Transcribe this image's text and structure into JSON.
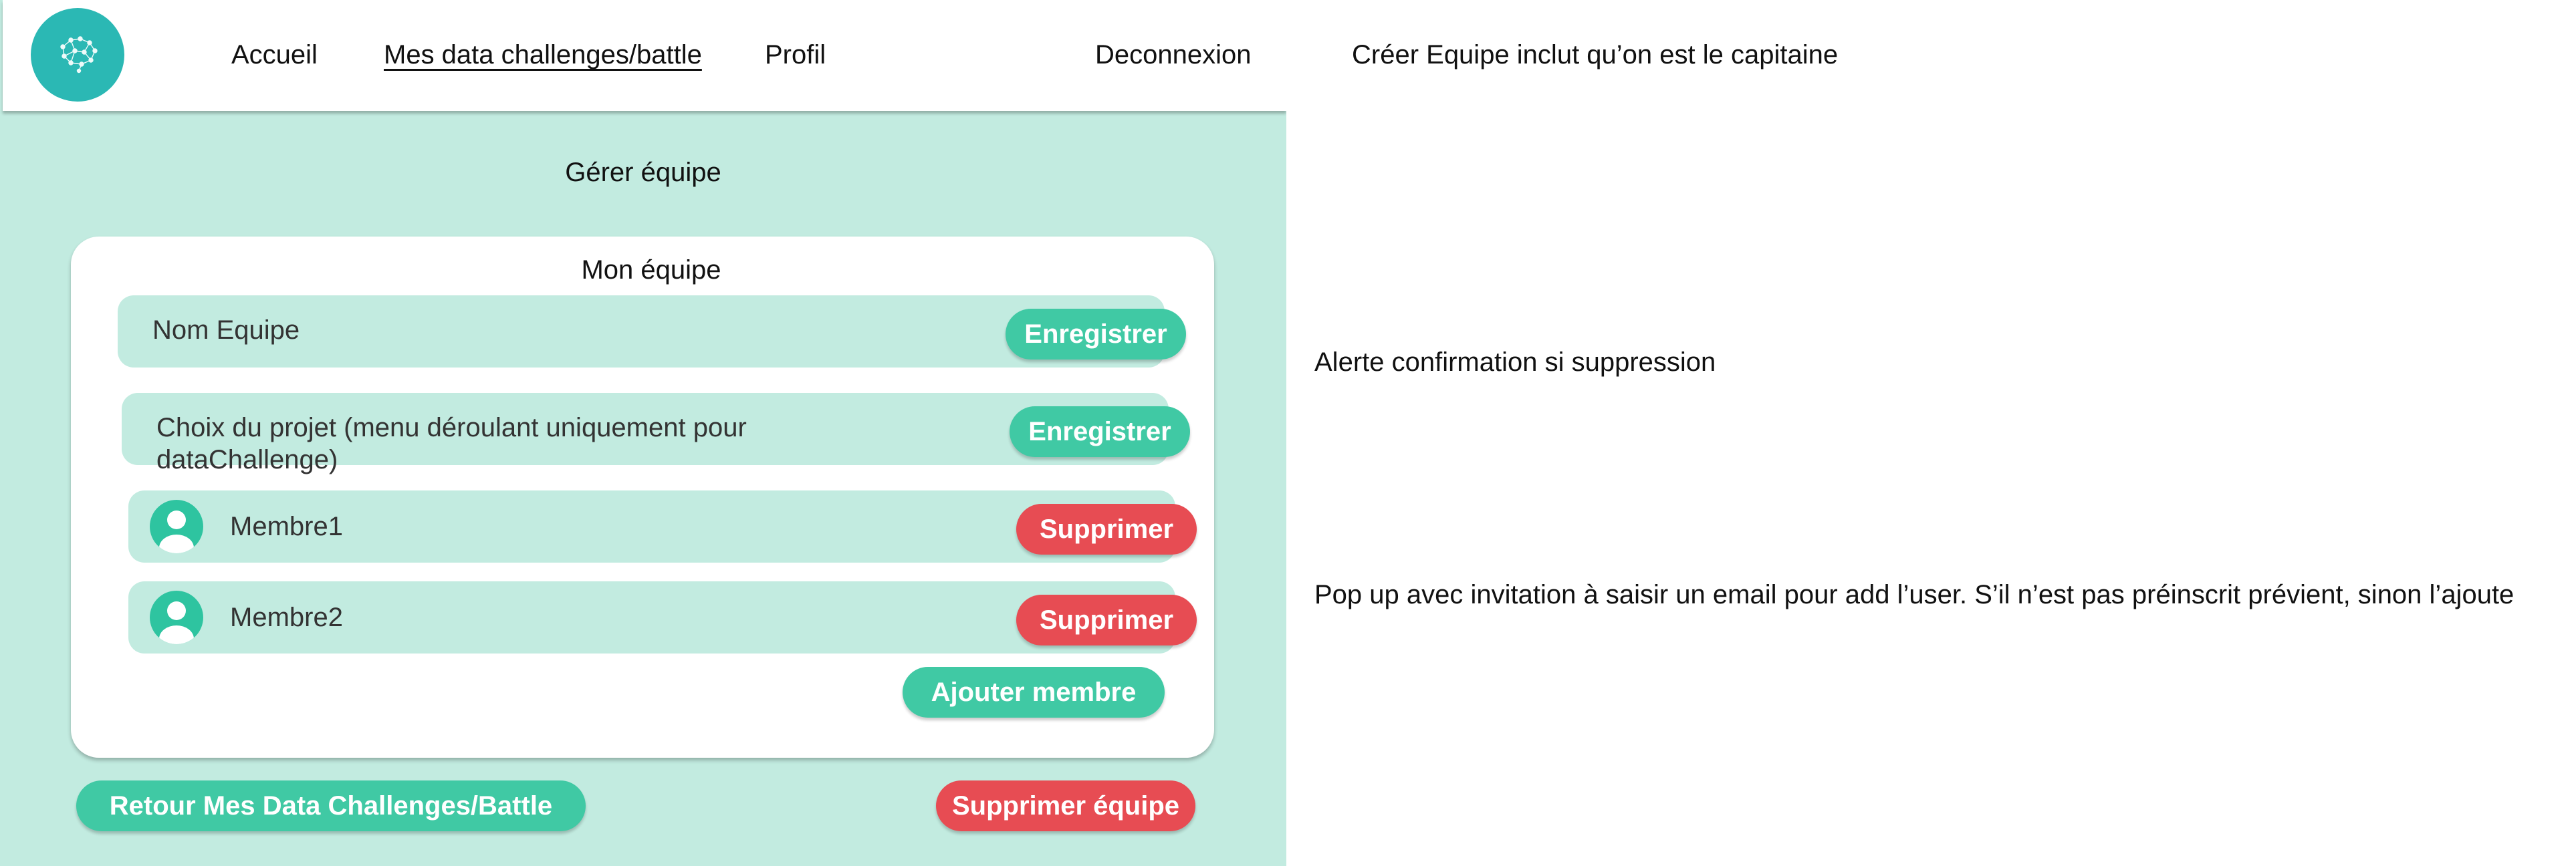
{
  "navbar": {
    "links": {
      "home": "Accueil",
      "challenges": "Mes data challenges/battle",
      "profile": "Profil",
      "logout": "Deconnexion"
    }
  },
  "page": {
    "title": "Gérer équipe"
  },
  "team_card": {
    "title": "Mon équipe",
    "team_name_row": {
      "label": "Nom Equipe",
      "save_label": "Enregistrer"
    },
    "project_row": {
      "label_line1": "Choix du projet (menu déroulant uniquement pour",
      "label_line2": "dataChallenge)",
      "save_label": "Enregistrer"
    },
    "members": [
      {
        "name": "Membre1",
        "remove_label": "Supprimer"
      },
      {
        "name": "Membre2",
        "remove_label": "Supprimer"
      }
    ],
    "add_member_label": "Ajouter membre"
  },
  "footer_actions": {
    "back_label": "Retour Mes Data Challenges/Battle",
    "delete_team_label": "Supprimer équipe"
  },
  "annotations": {
    "create_team_note": "Créer Equipe inclut qu’on est le capitaine",
    "delete_confirm_note": "Alerte confirmation si suppression",
    "invite_note": "Pop up avec invitation à saisir un email pour add l’user. S’il n’est pas préinscrit prévient, sinon l’ajoute"
  },
  "colors": {
    "page_background": "#c2ebe0",
    "row_background": "#c2ebe0",
    "primary_green": "#40c9a4",
    "danger_red": "#e74c53",
    "logo_teal": "#2bb8b4"
  },
  "icons": {
    "logo": "brain-logo-icon",
    "avatar": "user-avatar-icon"
  }
}
